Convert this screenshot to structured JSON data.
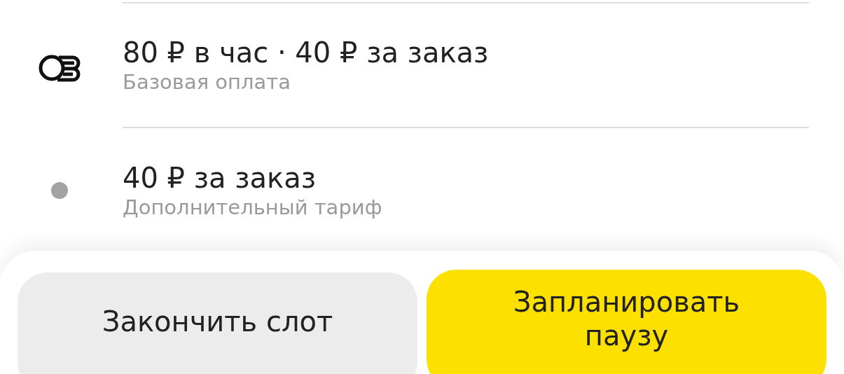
{
  "rows": [
    {
      "kind": "coins",
      "title": "80 ₽ в час · 40 ₽ за заказ",
      "subtitle": "Базовая оплата"
    },
    {
      "kind": "dot",
      "title": "40 ₽ за заказ",
      "subtitle": "Дополнительный тариф"
    }
  ],
  "buttons": [
    {
      "kind": "secondary",
      "label": "Закончить слот"
    },
    {
      "kind": "primary",
      "label": "Запланировать паузу"
    }
  ]
}
